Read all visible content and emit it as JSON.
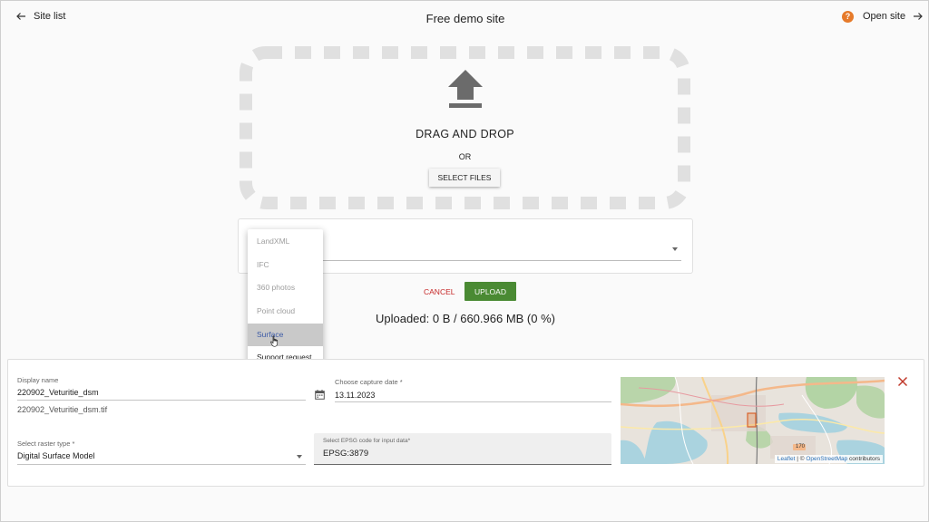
{
  "header": {
    "back_label": "Site list",
    "title": "Free demo site",
    "open_label": "Open site",
    "help_glyph": "?"
  },
  "dropzone": {
    "drag_text": "DRAG AND DROP",
    "or_text": "OR",
    "select_files_label": "SELECT FILES"
  },
  "type_select": {
    "options": [
      {
        "label": "LandXML",
        "state": "disabled"
      },
      {
        "label": "IFC",
        "state": "disabled"
      },
      {
        "label": "360 photos",
        "state": "disabled"
      },
      {
        "label": "Point cloud",
        "state": "disabled"
      },
      {
        "label": "Surface",
        "state": "highlighted"
      },
      {
        "label": "Support request",
        "state": "enabled"
      }
    ]
  },
  "actions": {
    "cancel_label": "CANCEL",
    "upload_label": "UPLOAD"
  },
  "status": {
    "uploaded_text": "Uploaded: 0 B / 660.966 MB (0 %)"
  },
  "file": {
    "display_name_label": "Display name",
    "display_name_value": "220902_Veturitie_dsm",
    "file_name": "220902_Veturitie_dsm.tif",
    "capture_date_label": "Choose capture date *",
    "capture_date_value": "13.11.2023",
    "raster_type_label": "Select raster type *",
    "raster_type_value": "Digital Surface Model",
    "epsg_label": "Select EPSG code for input data*",
    "epsg_value": "EPSG:3879",
    "map_road_number": "170",
    "map_attr_leaflet": "Leaflet",
    "map_attr_sep": " | © ",
    "map_attr_osm": "OpenStreetMap",
    "map_attr_suffix": " contributors"
  },
  "colors": {
    "upload_green": "#4a8a33",
    "cancel_red": "#c62828",
    "help_orange": "#e67a2a",
    "close_red": "#c0392b",
    "selected_blue": "#3c5aa6"
  },
  "icons": {
    "back": "arrow-left-icon",
    "forward": "arrow-right-icon",
    "help": "help-icon",
    "upload": "upload-icon",
    "calendar": "calendar-icon",
    "close": "close-icon",
    "cursor": "hand-pointer-icon"
  }
}
